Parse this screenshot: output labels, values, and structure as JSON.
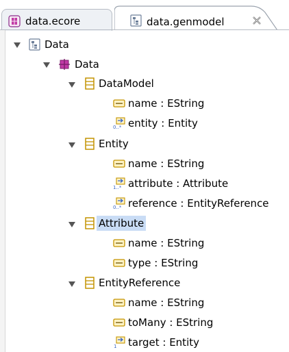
{
  "tabs": [
    {
      "label": "data.ecore",
      "icon": "ecore-package-icon",
      "active": false
    },
    {
      "label": "data.genmodel",
      "icon": "genmodel-icon",
      "active": true
    }
  ],
  "tree": {
    "root": "Data",
    "package": "Data",
    "classes": [
      {
        "name": "DataModel",
        "features": [
          {
            "label": "name : EString",
            "kind": "attribute"
          },
          {
            "label": "entity : Entity",
            "kind": "reference",
            "mult": "0..*"
          }
        ]
      },
      {
        "name": "Entity",
        "features": [
          {
            "label": "name : EString",
            "kind": "attribute"
          },
          {
            "label": "attribute : Attribute",
            "kind": "reference",
            "mult": "1..*"
          },
          {
            "label": "reference : EntityReference",
            "kind": "reference",
            "mult": "0..*"
          }
        ]
      },
      {
        "name": "Attribute",
        "selected": true,
        "features": [
          {
            "label": "name : EString",
            "kind": "attribute"
          },
          {
            "label": "type : EString",
            "kind": "attribute"
          }
        ]
      },
      {
        "name": "EntityReference",
        "features": [
          {
            "label": "name : EString",
            "kind": "attribute"
          },
          {
            "label": "toMany : EString",
            "kind": "attribute"
          },
          {
            "label": "target : Entity",
            "kind": "reference",
            "mult": "1"
          }
        ]
      }
    ]
  },
  "colors": {
    "selection": "#c9dcf5",
    "class_icon": "#d9a200",
    "attribute_icon": "#e2b000",
    "package_icon": "#8a2a8a",
    "reference_arrow": "#3a66c4"
  }
}
